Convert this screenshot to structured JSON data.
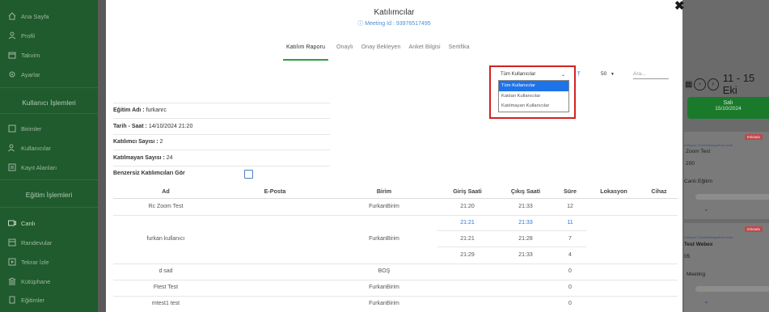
{
  "sidebar": {
    "items_top": [
      {
        "label": "Ana Sayfa",
        "icon": "home-icon"
      },
      {
        "label": "Profil",
        "icon": "user-icon"
      },
      {
        "label": "Takvim",
        "icon": "calendar-icon"
      },
      {
        "label": "Ayarlar",
        "icon": "gear-icon"
      }
    ],
    "section1": "Kullanıcı İşlemleri",
    "items_users": [
      {
        "label": "Birimler",
        "icon": "units-icon"
      },
      {
        "label": "Kullanıcılar",
        "icon": "users-icon"
      },
      {
        "label": "Kayıt Alanları",
        "icon": "register-icon"
      }
    ],
    "section2": "Eğitim İşlemleri",
    "items_edu": [
      {
        "label": "Canlı",
        "icon": "live-icon"
      },
      {
        "label": "Randevular",
        "icon": "appointment-icon"
      },
      {
        "label": "Tekrar İzle",
        "icon": "replay-icon"
      },
      {
        "label": "Kütüphane",
        "icon": "library-icon"
      },
      {
        "label": "Eğitimler",
        "icon": "courses-icon"
      }
    ]
  },
  "calendar": {
    "range": "11 - 15 Eki",
    "day_name": "Salı",
    "day_date": "15/10/2024",
    "card1": {
      "badge": "Eskiadu",
      "line1": "Zoom Test",
      "line2": "200",
      "line3": "Canlı Eğitim",
      "sub": "Kategori: EventManagerKurumsal"
    },
    "card2": {
      "badge": "Eskiadu",
      "line1": "Test Webex",
      "line2": "05",
      "line3": "Meeting",
      "sub": "Kategori: EventManagerKurumsal"
    }
  },
  "modal": {
    "title": "Katılımcılar",
    "meeting_id": "Meeting Id : 93976517495",
    "close_icon": "close-icon",
    "tabs": [
      "Katılım Raporu",
      "Onaylı",
      "Onay Bekleyen",
      "Anket Bilgisi",
      "Sertifika"
    ],
    "active_tab": "Katılım Raporu"
  },
  "filter": {
    "selected": "Tüm Kullanıcılar",
    "options": [
      "Tüm Kullanıcılar",
      "Katılan Kullanıcılar",
      "Katılmayan Kullanıcılar"
    ],
    "highlight_color": "#d32222"
  },
  "page_size": "50",
  "search_placeholder": "Ara...",
  "info": {
    "egitim_label": "Eğitim Adı :",
    "egitim_value": "furkanrc",
    "tarih_label": "Tarih - Saat :",
    "tarih_value": "14/10/2024 21:20",
    "katilimci_label": "Katılımcı Sayısı :",
    "katilimci_value": "2",
    "katilmayan_label": "Katılmayan Sayısı :",
    "katilmayan_value": "24",
    "benzersiz_label": "Benzersiz Katılımcıları Gör"
  },
  "table": {
    "headers": [
      "Ad",
      "E-Posta",
      "Birim",
      "Giriş Saati",
      "Çıkış Saati",
      "Süre",
      "Lokasyon",
      "Cihaz"
    ],
    "rows": [
      {
        "ad": "Rc Zoom Test",
        "birim": "FurkanBirim",
        "sessions": [
          {
            "giris": "21:20",
            "cikis": "21:33",
            "sure": "12"
          }
        ]
      },
      {
        "ad": "furkan kullanıcı",
        "birim": "FurkanBirim",
        "sessions": [
          {
            "giris": "21:21",
            "cikis": "21:33",
            "sure": "11"
          },
          {
            "giris": "21:21",
            "cikis": "21:28",
            "sure": "7"
          },
          {
            "giris": "21:29",
            "cikis": "21:33",
            "sure": "4"
          }
        ]
      },
      {
        "ad": "d sad",
        "birim": "BOŞ",
        "sessions": [
          {
            "giris": "",
            "cikis": "",
            "sure": "0"
          }
        ]
      },
      {
        "ad": "Ftest Test",
        "birim": "FurkanBirim",
        "sessions": [
          {
            "giris": "",
            "cikis": "",
            "sure": "0"
          }
        ]
      },
      {
        "ad": "mtest1 test",
        "birim": "FurkanBirim",
        "sessions": [
          {
            "giris": "",
            "cikis": "",
            "sure": "0"
          }
        ]
      }
    ]
  },
  "colors": {
    "accent_green": "#2f9e44",
    "link_blue": "#1e73e8",
    "sidebar": "#1f5b2c"
  }
}
